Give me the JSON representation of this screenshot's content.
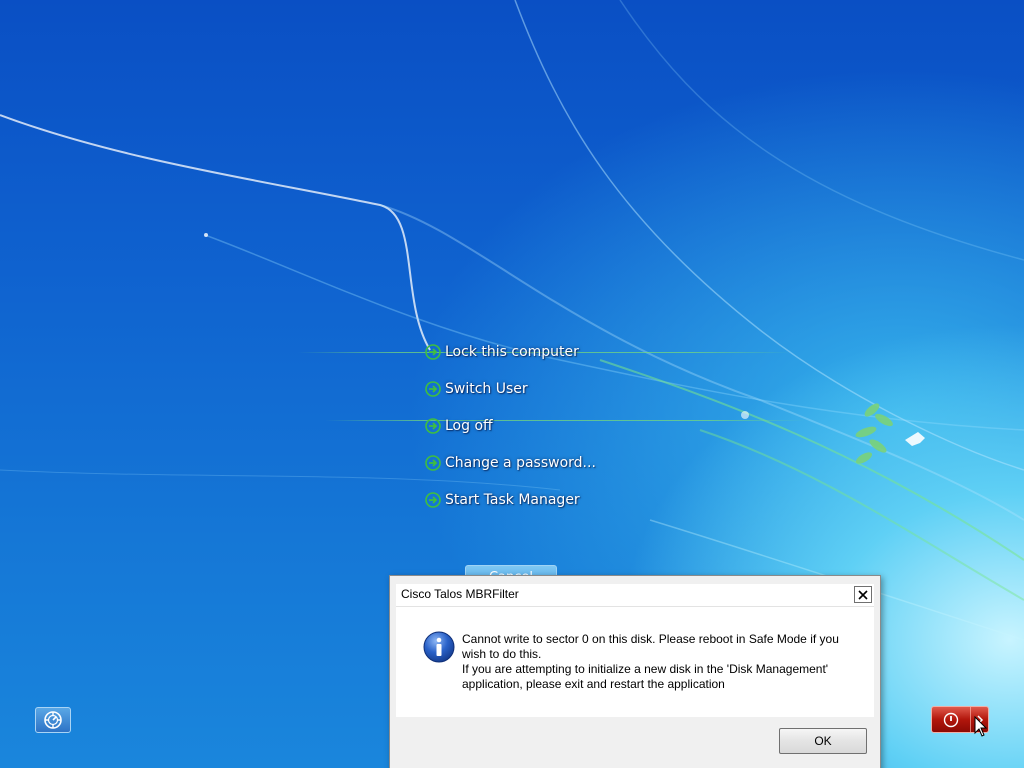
{
  "window": {
    "title": "Cisco Talos MBRFilter"
  },
  "options_menu": {
    "items": [
      {
        "label": "Lock this computer",
        "icon": "green-arrow-icon"
      },
      {
        "label": "Switch User",
        "icon": "green-arrow-icon"
      },
      {
        "label": "Log off",
        "icon": "green-arrow-icon"
      },
      {
        "label": "Change a password...",
        "icon": "green-arrow-icon"
      },
      {
        "label": "Start Task Manager",
        "icon": "green-arrow-icon"
      }
    ],
    "cancel_label": "Cancel"
  },
  "dialog": {
    "title": "Cisco Talos MBRFilter",
    "icon": "info-icon",
    "message_lines": [
      "Cannot write to sector 0 on this disk. Please reboot in Safe Mode if you wish to do this.",
      "If you are attempting to initialize a new disk in the 'Disk Management' application, please exit and restart the application"
    ],
    "ok_label": "OK",
    "close_icon": "close-icon"
  },
  "controls": {
    "ease_of_access_icon": "ease-of-access-icon",
    "shutdown_icon": "power-icon",
    "shutdown_options_icon": "chevron-right-icon"
  },
  "colors": {
    "background_top": "#0a4fc4",
    "background_bottom": "#1a86dc",
    "shutdown_red": "#b2160c",
    "ease_blue": "#2d73c6",
    "arrow_green": "#3fbf3f"
  }
}
